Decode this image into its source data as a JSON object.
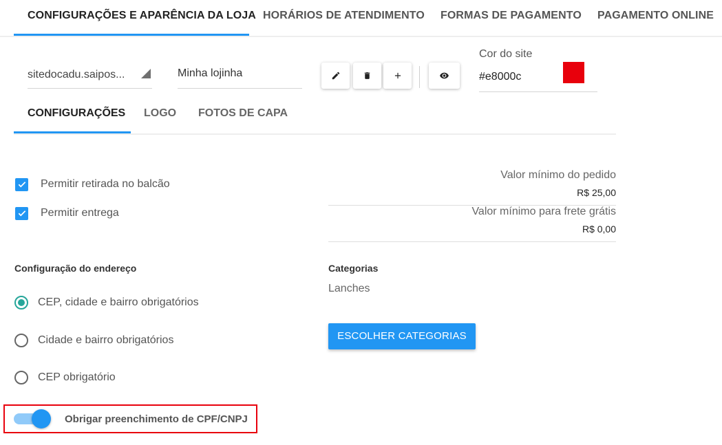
{
  "top_tabs": [
    {
      "label": "CONFIGURAÇÕES E APARÊNCIA DA LOJA",
      "active": true
    },
    {
      "label": "HORÁRIOS DE ATENDIMENTO",
      "active": false
    },
    {
      "label": "FORMAS DE PAGAMENTO",
      "active": false
    },
    {
      "label": "PAGAMENTO ONLINE",
      "active": false
    }
  ],
  "store": {
    "site_selected": "sitedocadu.saipos...",
    "store_name": "Minha lojinha",
    "actions": [
      {
        "name": "edit",
        "icon": "pencil-icon"
      },
      {
        "name": "delete",
        "icon": "trash-icon"
      },
      {
        "name": "add",
        "icon": "plus-icon"
      },
      {
        "name": "preview",
        "icon": "eye-icon"
      }
    ],
    "color_label": "Cor do site",
    "color_value": "#e8000c",
    "color_hex": "#e8000c"
  },
  "sub_tabs": [
    {
      "label": "CONFIGURAÇÕES",
      "active": true
    },
    {
      "label": "LOGO",
      "active": false
    },
    {
      "label": "FOTOS DE CAPA",
      "active": false
    }
  ],
  "options": [
    {
      "label": "Permitir retirada no balcão",
      "checked": true
    },
    {
      "label": "Permitir entrega",
      "checked": true
    }
  ],
  "min_values": [
    {
      "label": "Valor mínimo do pedido",
      "value": "R$ 25,00"
    },
    {
      "label": "Valor mínimo para frete grátis",
      "value": "R$ 0,00"
    }
  ],
  "address": {
    "title": "Configuração do endereço",
    "options": [
      {
        "label": "CEP, cidade e bairro obrigatórios",
        "selected": true
      },
      {
        "label": "Cidade e bairro obrigatórios",
        "selected": false
      },
      {
        "label": "CEP obrigatório",
        "selected": false
      }
    ]
  },
  "categories": {
    "title": "Categorias",
    "value": "Lanches",
    "button_label": "ESCOLHER CATEGORIAS"
  },
  "cpf_toggle": {
    "label": "Obrigar preenchimento de CPF/CNPJ",
    "on": true
  },
  "colors": {
    "accent": "#2196f3",
    "radio": "#26a69a",
    "highlight": "#e8000c"
  }
}
